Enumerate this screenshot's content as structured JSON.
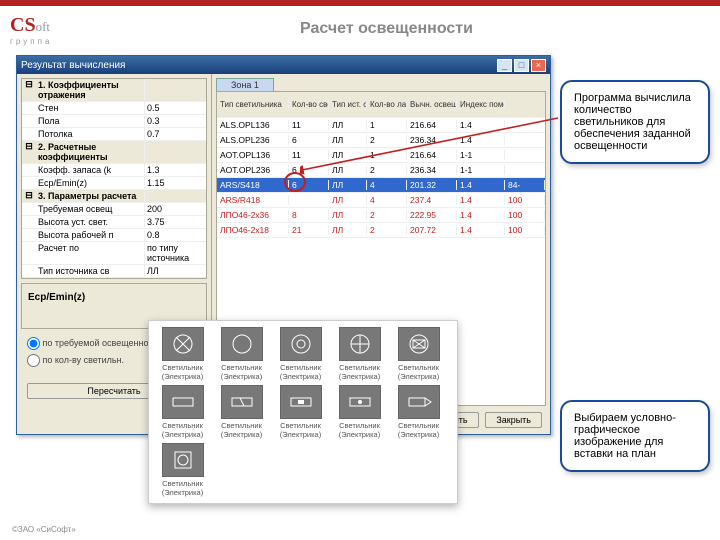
{
  "slide": {
    "title": "Расчет освещенности",
    "copyright": "©ЗАО «СиСофт»"
  },
  "window": {
    "title": "Результат вычисления",
    "zone_tab": "Зона 1",
    "props": {
      "cat1": "1. Коэффициенты отражения",
      "cat2": "2. Расчетные коэффициенты",
      "cat3": "3. Параметры расчета",
      "rows": [
        {
          "k": "Стен",
          "v": "0.5"
        },
        {
          "k": "Пола",
          "v": "0.3"
        },
        {
          "k": "Потолка",
          "v": "0.7"
        },
        {
          "k": "Коэфф. запаса (k",
          "v": "1.3"
        },
        {
          "k": "Eср/Emin(z)",
          "v": "1.15"
        },
        {
          "k": "Требуемая освещ",
          "v": "200"
        },
        {
          "k": "Высота уст. свет.",
          "v": "3.75"
        },
        {
          "k": "Высота рабочей п",
          "v": "0.8"
        },
        {
          "k": "Расчет по",
          "v": "по типу источника"
        },
        {
          "k": "Тип источника св",
          "v": "ЛЛ"
        }
      ],
      "ecp_label": "Eср/Emin(z)"
    },
    "radios": {
      "r1": "по требуемой освещенности",
      "r2": "по кол-ву светильн."
    },
    "recalc": "Пересчитать",
    "columns": [
      "Тип светильника",
      "Кол-во свет-ов",
      "Тип ист. света",
      "Кол-во ламп",
      "Вычн. освещен.",
      "Индекс помещения",
      ""
    ],
    "rows": [
      {
        "c": [
          "ALS.OPL136",
          "11",
          "ЛЛ",
          "1",
          "216.64",
          "1.4",
          ""
        ],
        "cls": ""
      },
      {
        "c": [
          "ALS.OPL236",
          "6",
          "ЛЛ",
          "2",
          "236.34",
          "1.4",
          ""
        ],
        "cls": ""
      },
      {
        "c": [
          "AOT.OPL136",
          "11",
          "ЛЛ",
          "1",
          "216.64",
          "1-1",
          ""
        ],
        "cls": ""
      },
      {
        "c": [
          "AOT.OPL236",
          "6",
          "ЛЛ",
          "2",
          "236.34",
          "1-1",
          ""
        ],
        "cls": ""
      },
      {
        "c": [
          "ARS/S418",
          "6",
          "ЛЛ",
          "4",
          "201.32",
          "1.4",
          "84-"
        ],
        "cls": "sel"
      },
      {
        "c": [
          "ARS/R418",
          "",
          "ЛЛ",
          "4",
          "237.4",
          "1.4",
          "100"
        ],
        "cls": "red"
      },
      {
        "c": [
          "ЛПО46-2x36",
          "8",
          "ЛЛ",
          "2",
          "222.95",
          "1.4",
          "100"
        ],
        "cls": "red"
      },
      {
        "c": [
          "ЛПО46-2x18",
          "21",
          "ЛЛ",
          "2",
          "207.72",
          "1.4",
          "100"
        ],
        "cls": "red"
      }
    ],
    "btn_place": "Поместить",
    "btn_close": "Закрыть"
  },
  "symbols": {
    "label_line1": "Светильник",
    "label_line2": "(Электрика)"
  },
  "callouts": {
    "c1": "Программа вычислила количество светильников для обеспечения заданной освещенности",
    "c2": "Выбираем условно-графическое изображение для вставки на план"
  }
}
